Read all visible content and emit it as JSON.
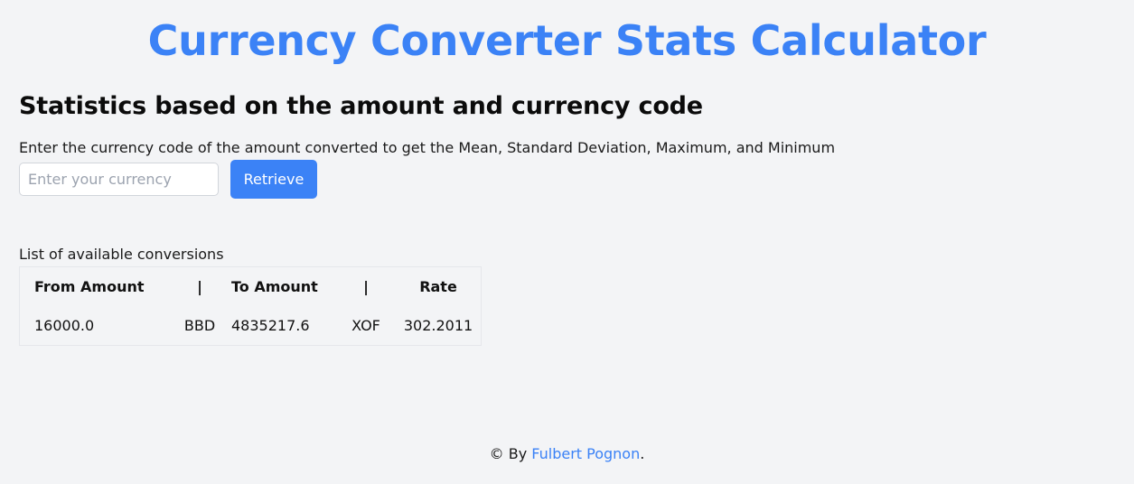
{
  "header": {
    "title": "Currency Converter Stats Calculator"
  },
  "main": {
    "subtitle": "Statistics based on the amount and currency code",
    "instructions": "Enter the currency code of the amount converted to get the Mean, Standard Deviation, Maximum, and Minimum",
    "currency_input": {
      "placeholder": "Enter your currency",
      "value": ""
    },
    "retrieve_label": "Retrieve",
    "list_caption": "List of available conversions",
    "table": {
      "headers": [
        "From Amount",
        "|",
        "To Amount",
        "|",
        "Rate"
      ],
      "rows": [
        [
          "16000.0",
          "BBD",
          "4835217.6",
          "XOF",
          "302.2011"
        ]
      ]
    }
  },
  "footer": {
    "prefix": "© By ",
    "author": "Fulbert Pognon",
    "suffix": "."
  },
  "colors": {
    "accent": "#3b82f6",
    "background": "#f3f4f6"
  }
}
